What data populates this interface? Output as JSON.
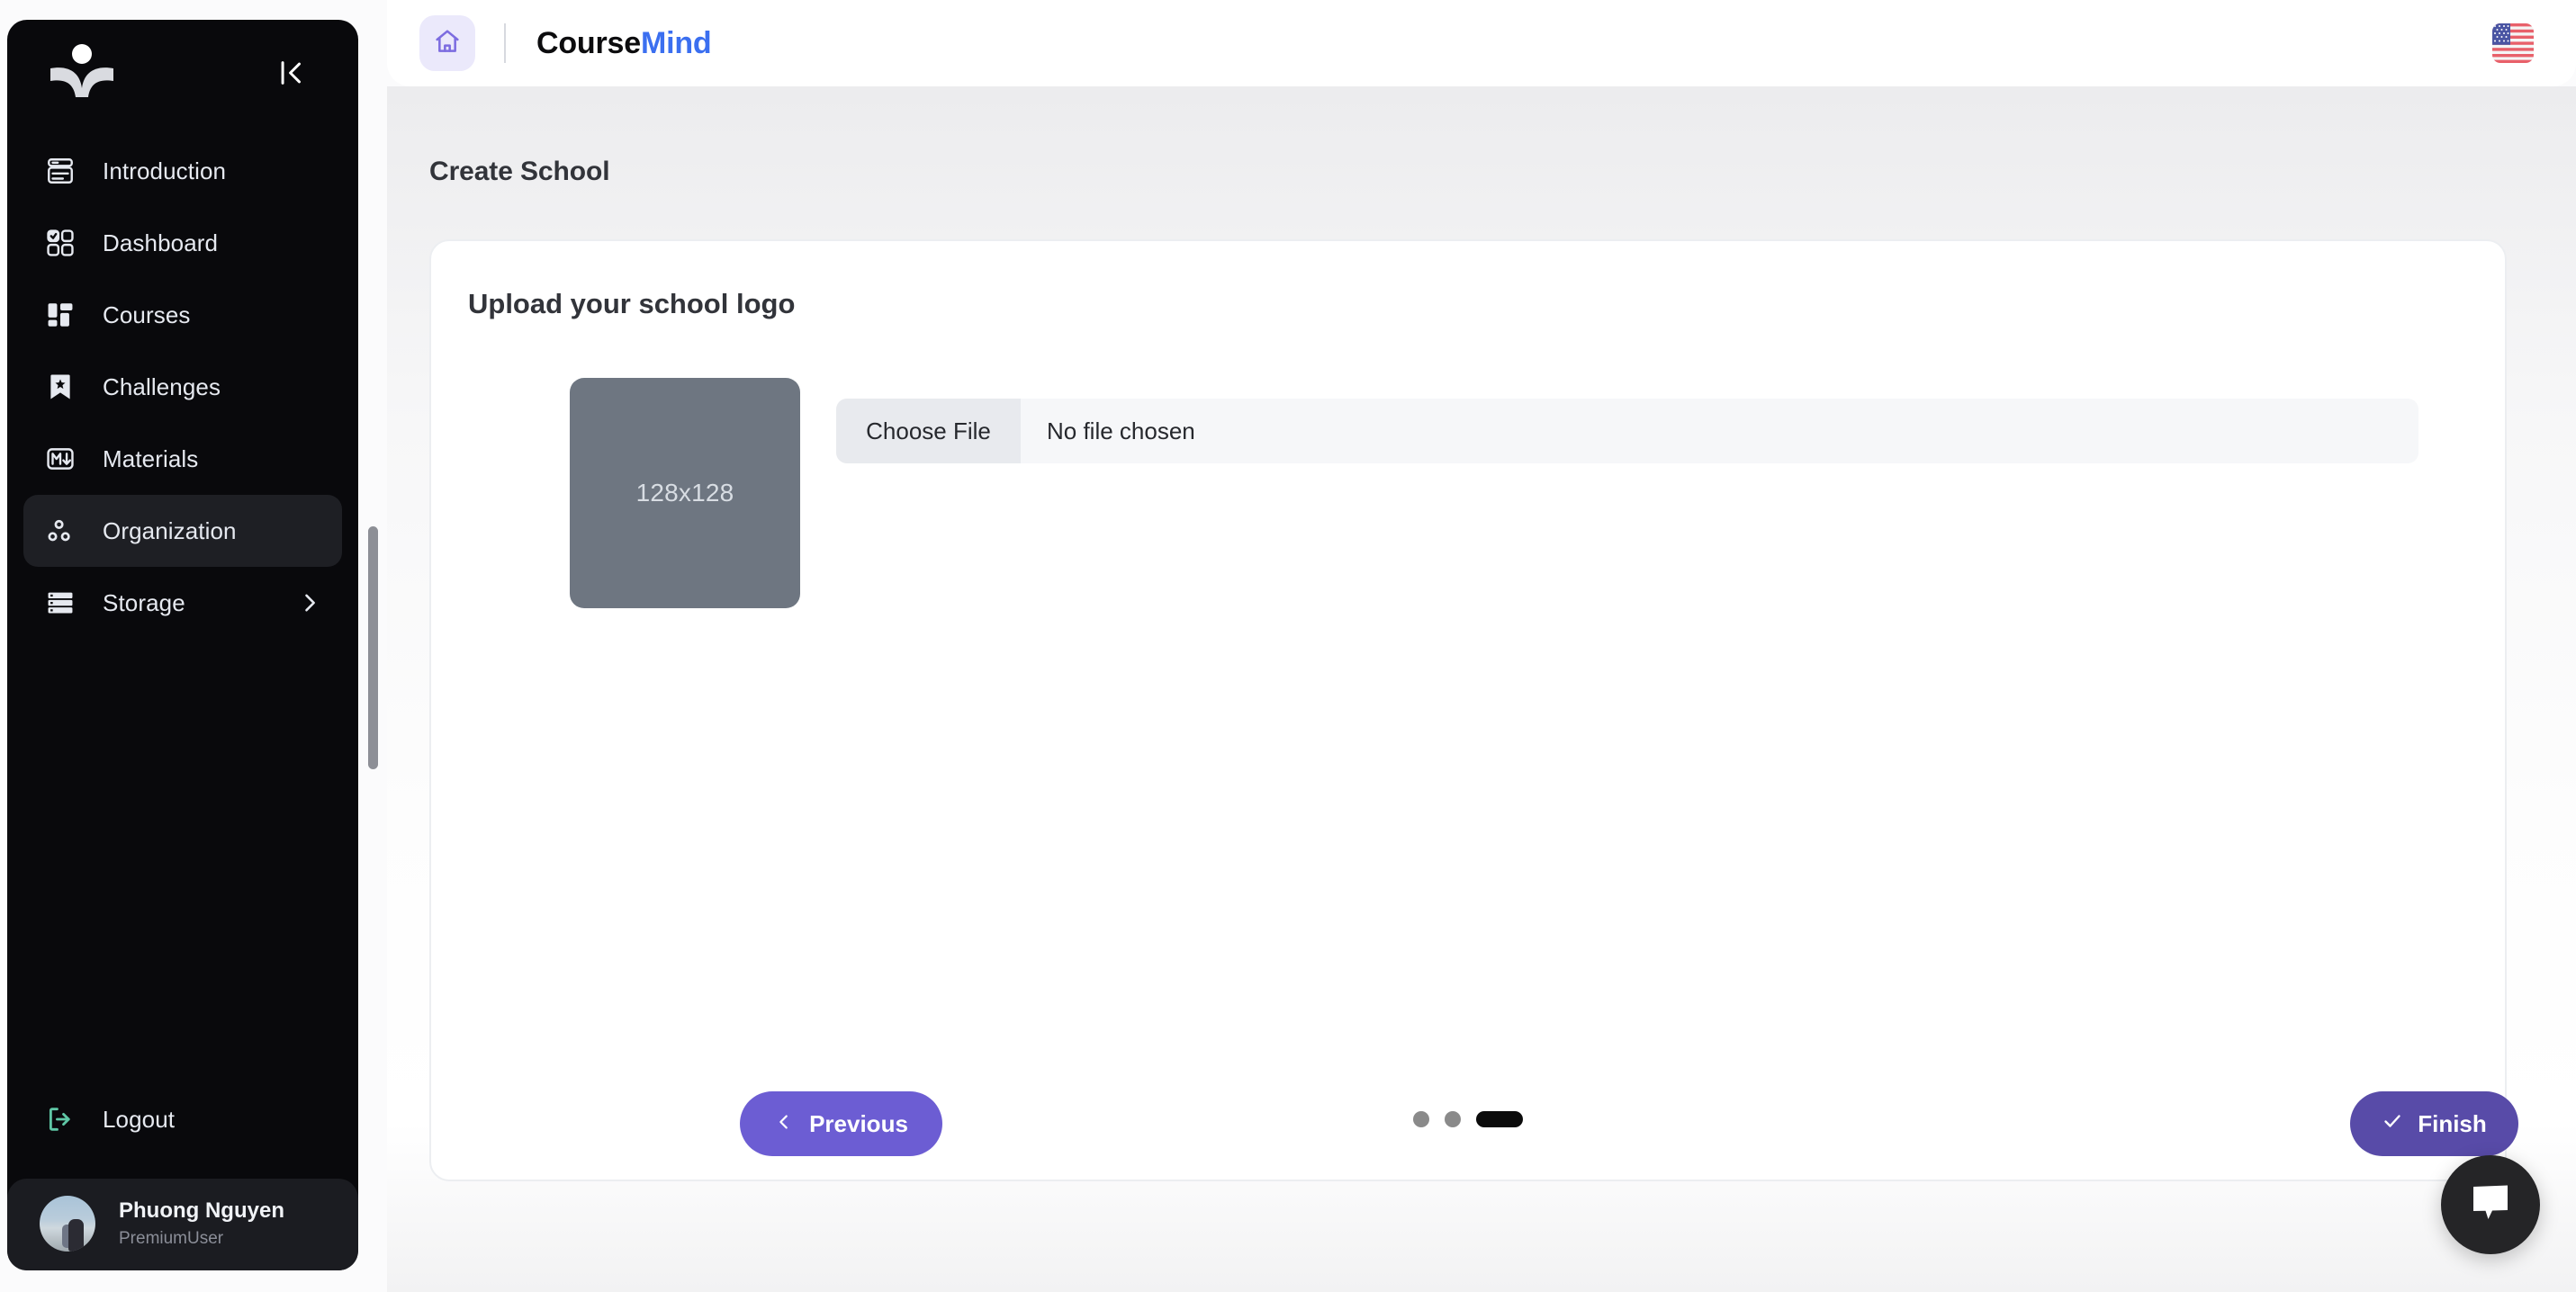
{
  "sidebar": {
    "brand_icon": "graduation-reader-logo",
    "collapse_icon": "collapse-panel-icon",
    "items": [
      {
        "label": "Introduction",
        "icon": "card-list-icon",
        "active": false,
        "chevron": false
      },
      {
        "label": "Dashboard",
        "icon": "grid-check-icon",
        "active": false,
        "chevron": false
      },
      {
        "label": "Courses",
        "icon": "layout-grid-icon",
        "active": false,
        "chevron": false
      },
      {
        "label": "Challenges",
        "icon": "bookmark-star-icon",
        "active": false,
        "chevron": false
      },
      {
        "label": "Materials",
        "icon": "markdown-icon",
        "active": false,
        "chevron": false
      },
      {
        "label": "Organization",
        "icon": "org-nodes-icon",
        "active": true,
        "chevron": false
      },
      {
        "label": "Storage",
        "icon": "server-stack-icon",
        "active": false,
        "chevron": true
      }
    ],
    "logout": {
      "label": "Logout",
      "icon": "logout-icon",
      "color": "#5fc7a6"
    },
    "profile": {
      "name": "Phuong Nguyen",
      "role": "PremiumUser",
      "avatar": "user-avatar-photo"
    }
  },
  "topbar": {
    "home_icon": "home-icon",
    "title_part1": "Course",
    "title_part2": "Mind",
    "language_flag": "us-flag-icon",
    "accent_blue": "#3b6ff0",
    "home_bg": "#ebe9fb"
  },
  "main": {
    "page_title": "Create School",
    "card": {
      "title": "Upload your school logo",
      "thumbnail_label": "128x128",
      "thumbnail_bg": "#6e7681",
      "file_input": {
        "button_label": "Choose File",
        "value": "No file chosen"
      },
      "footer": {
        "previous": {
          "label": "Previous",
          "icon": "chevron-left-icon",
          "color": "#6c5dd3"
        },
        "finish": {
          "label": "Finish",
          "icon": "check-icon",
          "color": "#584ba8"
        },
        "steps": {
          "total": 3,
          "current": 3
        }
      }
    }
  },
  "chat_widget": {
    "icon": "chat-bubble-icon",
    "bg": "#252527"
  }
}
